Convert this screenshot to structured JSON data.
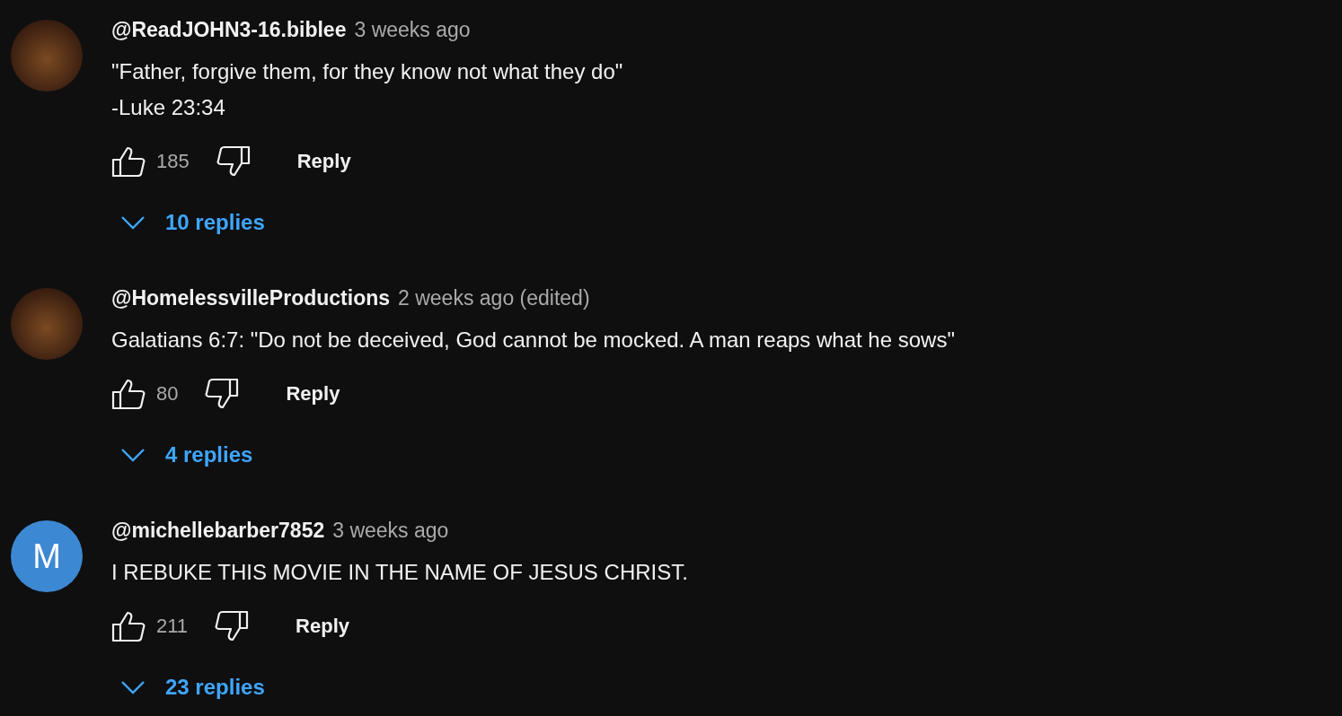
{
  "comments": [
    {
      "avatar": {
        "kind": "photo"
      },
      "author": "@ReadJOHN3-16.biblee",
      "time": "3 weeks ago",
      "body": [
        "\"Father, forgive them, for they know not what they do\"",
        "-Luke 23:34"
      ],
      "likes": "185",
      "reply_label": "Reply",
      "replies": "10 replies"
    },
    {
      "avatar": {
        "kind": "photo"
      },
      "author": "@HomelessvilleProductions",
      "time": "2 weeks ago (edited)",
      "body": [
        "Galatians 6:7: \"Do not be deceived, God cannot be mocked. A man reaps what he sows\""
      ],
      "likes": "80",
      "reply_label": "Reply",
      "replies": "4 replies"
    },
    {
      "avatar": {
        "kind": "letter",
        "letter": "M",
        "color": "#3d88d2"
      },
      "author": "@michellebarber7852",
      "time": "3 weeks ago",
      "body": [
        "I REBUKE THIS MOVIE IN THE NAME OF JESUS CHRIST."
      ],
      "likes": "211",
      "reply_label": "Reply",
      "replies": "23 replies"
    }
  ]
}
